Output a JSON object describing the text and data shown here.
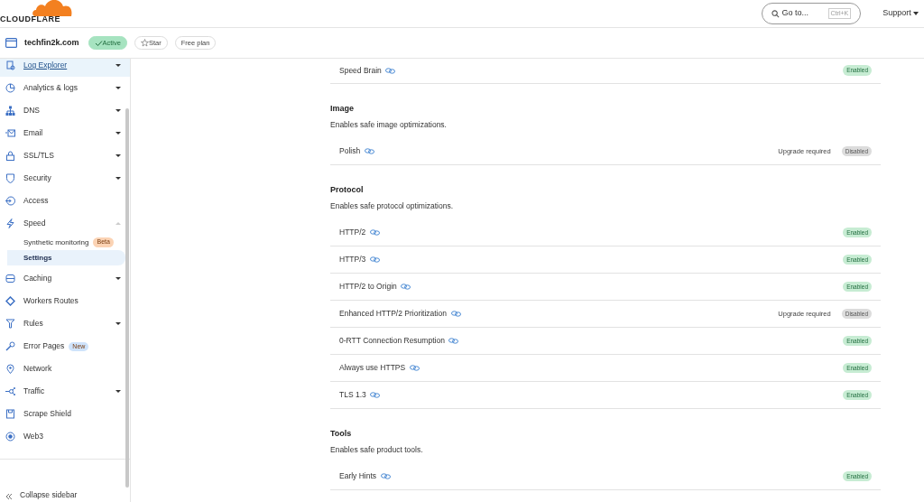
{
  "header": {
    "logo": "CLOUDFLARE",
    "search": {
      "placeholder": "Go to...",
      "shortcut": "Ctrl+K"
    },
    "support": "Support"
  },
  "site": {
    "name": "techfin2k.com",
    "status": "Active",
    "star": "Star",
    "plan": "Free plan"
  },
  "sidebar": {
    "items": [
      {
        "label": "Log Explorer",
        "selected": true,
        "expanded": false
      },
      {
        "label": "Analytics & logs",
        "selected": false,
        "expanded": false
      },
      {
        "label": "DNS",
        "selected": false,
        "expanded": false
      },
      {
        "label": "Email",
        "selected": false,
        "expanded": false
      },
      {
        "label": "SSL/TLS",
        "selected": false,
        "expanded": false
      },
      {
        "label": "Security",
        "selected": false,
        "expanded": false
      },
      {
        "label": "Access",
        "selected": false
      },
      {
        "label": "Speed",
        "selected": false,
        "expanded": true,
        "children": [
          {
            "label": "Synthetic monitoring",
            "selected": false,
            "badge": {
              "text": "Beta",
              "color": "#fbd3b4"
            }
          },
          {
            "label": "Settings",
            "selected": true
          }
        ]
      },
      {
        "label": "Caching",
        "selected": false,
        "expanded": false
      },
      {
        "label": "Workers Routes",
        "selected": false
      },
      {
        "label": "Rules",
        "selected": false,
        "expanded": false
      },
      {
        "label": "Error Pages",
        "selected": false,
        "badge": {
          "text": "New",
          "color": "#cfe3fb"
        }
      },
      {
        "label": "Network",
        "selected": false
      },
      {
        "label": "Traffic",
        "selected": false,
        "expanded": false
      },
      {
        "label": "Scrape Shield",
        "selected": false
      },
      {
        "label": "Web3",
        "selected": false
      }
    ],
    "collapse": "Collapse sidebar"
  },
  "sections": [
    {
      "rows": [
        {
          "label": "Speed Brain",
          "status": "Enabled",
          "enabled": true
        }
      ]
    },
    {
      "title": "Image",
      "description": "Enables safe image optimizations.",
      "rows": [
        {
          "label": "Polish",
          "note": "Upgrade required",
          "status": "Disabled",
          "enabled": false
        }
      ]
    },
    {
      "title": "Protocol",
      "description": "Enables safe protocol optimizations.",
      "rows": [
        {
          "label": "HTTP/2",
          "status": "Enabled",
          "enabled": true
        },
        {
          "label": "HTTP/3",
          "status": "Enabled",
          "enabled": true
        },
        {
          "label": "HTTP/2 to Origin",
          "status": "Enabled",
          "enabled": true
        },
        {
          "label": "Enhanced HTTP/2 Prioritization",
          "note": "Upgrade required",
          "status": "Disabled",
          "enabled": false
        },
        {
          "label": "0-RTT Connection Resumption",
          "status": "Enabled",
          "enabled": true
        },
        {
          "label": "Always use HTTPS",
          "status": "Enabled",
          "enabled": true
        },
        {
          "label": "TLS 1.3",
          "status": "Enabled",
          "enabled": true
        }
      ]
    },
    {
      "title": "Tools",
      "description": "Enables safe product tools.",
      "rows": [
        {
          "label": "Early Hints",
          "status": "Enabled",
          "enabled": true
        }
      ]
    }
  ]
}
